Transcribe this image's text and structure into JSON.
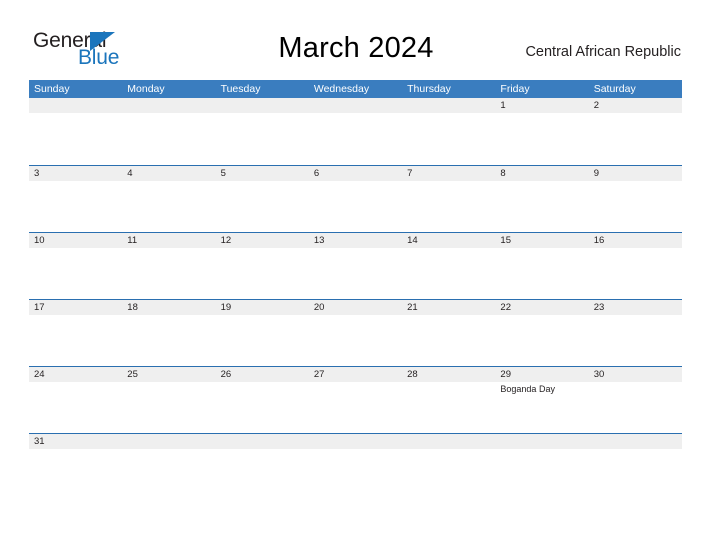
{
  "brand": {
    "name_part1": "General",
    "name_part2": "Blue",
    "triangle_icon": "triangle-logo-icon",
    "color_dark": "#231f20",
    "color_blue": "#1b75bc"
  },
  "header": {
    "title": "March 2024",
    "country": "Central African Republic"
  },
  "theme": {
    "header_blue": "#3a7dbf",
    "divider_blue": "#2a6fb0",
    "band_gray": "#efefef",
    "text": "#231f20"
  },
  "calendar": {
    "month": "March",
    "year": "2024",
    "weekday_headers": [
      "Sunday",
      "Monday",
      "Tuesday",
      "Wednesday",
      "Thursday",
      "Friday",
      "Saturday"
    ],
    "weeks": [
      {
        "days": [
          {
            "num": "",
            "event": ""
          },
          {
            "num": "",
            "event": ""
          },
          {
            "num": "",
            "event": ""
          },
          {
            "num": "",
            "event": ""
          },
          {
            "num": "",
            "event": ""
          },
          {
            "num": "1",
            "event": ""
          },
          {
            "num": "2",
            "event": ""
          }
        ]
      },
      {
        "days": [
          {
            "num": "3",
            "event": ""
          },
          {
            "num": "4",
            "event": ""
          },
          {
            "num": "5",
            "event": ""
          },
          {
            "num": "6",
            "event": ""
          },
          {
            "num": "7",
            "event": ""
          },
          {
            "num": "8",
            "event": ""
          },
          {
            "num": "9",
            "event": ""
          }
        ]
      },
      {
        "days": [
          {
            "num": "10",
            "event": ""
          },
          {
            "num": "11",
            "event": ""
          },
          {
            "num": "12",
            "event": ""
          },
          {
            "num": "13",
            "event": ""
          },
          {
            "num": "14",
            "event": ""
          },
          {
            "num": "15",
            "event": ""
          },
          {
            "num": "16",
            "event": ""
          }
        ]
      },
      {
        "days": [
          {
            "num": "17",
            "event": ""
          },
          {
            "num": "18",
            "event": ""
          },
          {
            "num": "19",
            "event": ""
          },
          {
            "num": "20",
            "event": ""
          },
          {
            "num": "21",
            "event": ""
          },
          {
            "num": "22",
            "event": ""
          },
          {
            "num": "23",
            "event": ""
          }
        ]
      },
      {
        "days": [
          {
            "num": "24",
            "event": ""
          },
          {
            "num": "25",
            "event": ""
          },
          {
            "num": "26",
            "event": ""
          },
          {
            "num": "27",
            "event": ""
          },
          {
            "num": "28",
            "event": ""
          },
          {
            "num": "29",
            "event": "Boganda Day"
          },
          {
            "num": "30",
            "event": ""
          }
        ]
      },
      {
        "days": [
          {
            "num": "31",
            "event": ""
          },
          {
            "num": "",
            "event": ""
          },
          {
            "num": "",
            "event": ""
          },
          {
            "num": "",
            "event": ""
          },
          {
            "num": "",
            "event": ""
          },
          {
            "num": "",
            "event": ""
          },
          {
            "num": "",
            "event": ""
          }
        ]
      }
    ]
  }
}
